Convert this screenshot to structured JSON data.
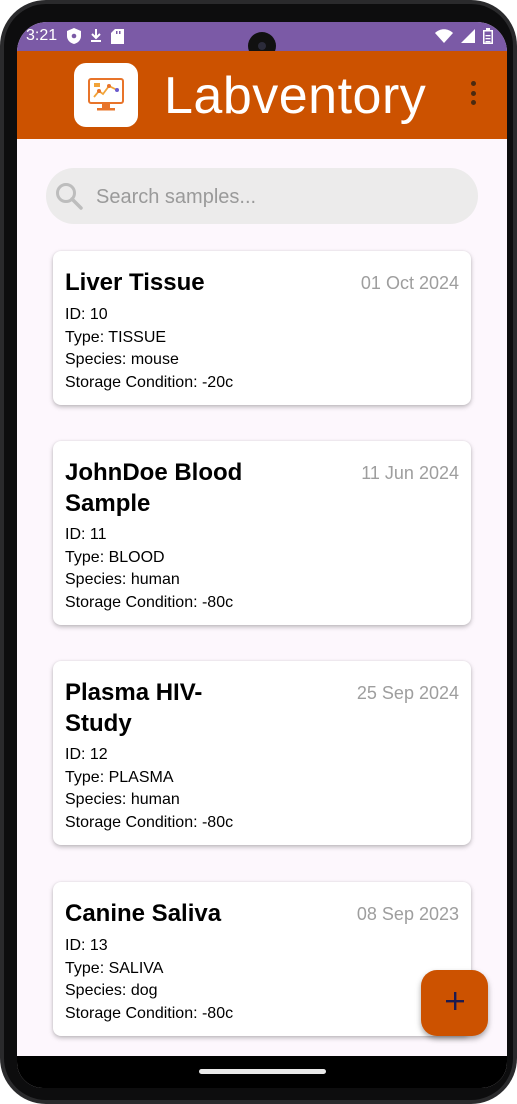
{
  "status_bar": {
    "time": "3:21",
    "bg_color": "#7b5aa6",
    "left_icons": [
      "shield-icon",
      "download-icon",
      "sd-card-icon"
    ],
    "right_icons": [
      "wifi-icon",
      "signal-icon",
      "battery-icon"
    ]
  },
  "app_bar": {
    "title": "Labventory",
    "bg_color": "#cc5200",
    "logo_icon": "lab-monitor-logo-icon",
    "menu_icon": "more-vert-icon"
  },
  "search": {
    "placeholder": "Search samples...",
    "value": ""
  },
  "samples": [
    {
      "title": "Liver Tissue",
      "date": "01 Oct 2024",
      "id": "ID: 10",
      "type": "Type: TISSUE",
      "species": "Species: mouse",
      "storage": "Storage Condition: -20c"
    },
    {
      "title": "JohnDoe Blood Sample",
      "date": "11 Jun 2024",
      "id": "ID: 11",
      "type": "Type: BLOOD",
      "species": "Species: human",
      "storage": "Storage Condition: -80c"
    },
    {
      "title": "Plasma HIV-Study",
      "date": "25 Sep 2024",
      "id": "ID: 12",
      "type": "Type: PLASMA",
      "species": "Species: human",
      "storage": "Storage Condition: -80c"
    },
    {
      "title": "Canine Saliva",
      "date": "08 Sep 2023",
      "id": "ID: 13",
      "type": "Type: SALIVA",
      "species": "Species: dog",
      "storage": "Storage Condition: -80c"
    }
  ],
  "fab": {
    "icon": "plus-icon",
    "label": "+",
    "color": "#cc5200"
  }
}
